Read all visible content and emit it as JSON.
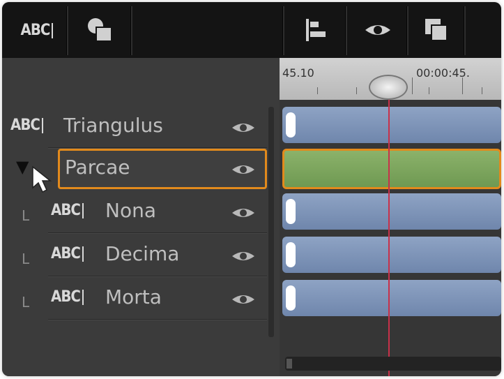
{
  "toolbar": {
    "title_tool_label": "ABC",
    "icons": [
      "title-abc-icon",
      "shapes-icon",
      "align-icon",
      "visibility-eye-icon",
      "duplicate-icon"
    ]
  },
  "timeline": {
    "timecode_left": "45.10",
    "timecode_right": "00:00:45.",
    "playhead_color": "#c8314a",
    "selection_color": "#e28a1c"
  },
  "layers": [
    {
      "type_label": "ABC",
      "name": "Triangulus",
      "prefix": ""
    },
    {
      "type_label": "",
      "name": "Parcae",
      "prefix": "▼"
    },
    {
      "type_label": "ABC",
      "name": "Nona",
      "prefix": "L"
    },
    {
      "type_label": "ABC",
      "name": "Decima",
      "prefix": "L"
    },
    {
      "type_label": "ABC",
      "name": "Morta",
      "prefix": "L"
    }
  ]
}
